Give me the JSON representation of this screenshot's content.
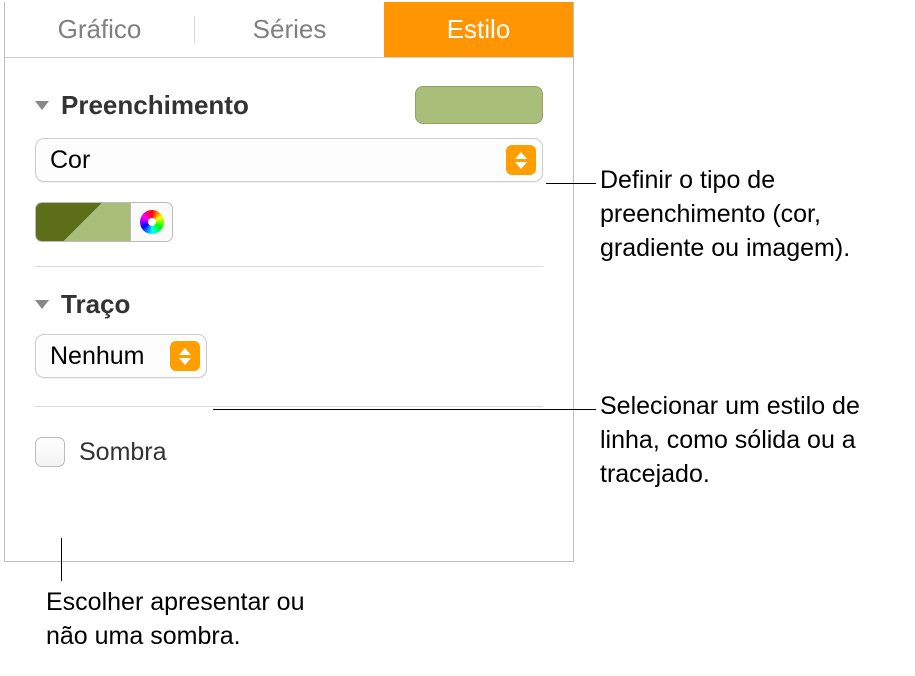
{
  "tabs": {
    "grafico": "Gráfico",
    "series": "Séries",
    "estilo": "Estilo"
  },
  "fill": {
    "title": "Preenchimento",
    "typeValue": "Cor",
    "wellColor": "#a8be79"
  },
  "stroke": {
    "title": "Traço",
    "value": "Nenhum"
  },
  "shadow": {
    "label": "Sombra"
  },
  "callouts": {
    "fillType": "Definir o tipo de preenchimento (cor, gradiente ou imagem).",
    "strokeStyle": "Selecionar um estilo de linha, como sólida ou a tracejado.",
    "shadowToggle": "Escolher apresentar ou não uma sombra."
  }
}
